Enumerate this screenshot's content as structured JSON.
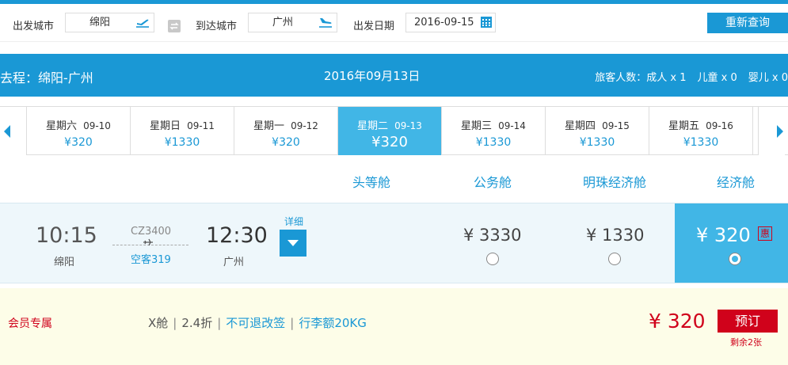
{
  "search": {
    "origin_label": "出发城市",
    "origin_value": "绵阳",
    "dest_label": "到达城市",
    "dest_value": "广州",
    "date_label": "出发日期",
    "date_value": "2016-09-15",
    "requery_label": "重新查询"
  },
  "route": {
    "title": "去程：绵阳-广州",
    "date": "2016年09月13日",
    "pax_label": "旅客人数：",
    "adult": "成人 x 1",
    "child": "儿童 x 0",
    "infant": "婴儿 x 0"
  },
  "date_tabs": [
    {
      "weekday": "星期六",
      "date": "09-10",
      "price": "¥320"
    },
    {
      "weekday": "星期日",
      "date": "09-11",
      "price": "¥1330"
    },
    {
      "weekday": "星期一",
      "date": "09-12",
      "price": "¥320"
    },
    {
      "weekday": "星期二",
      "date": "09-13",
      "price": "¥320",
      "active": true
    },
    {
      "weekday": "星期三",
      "date": "09-14",
      "price": "¥1330"
    },
    {
      "weekday": "星期四",
      "date": "09-15",
      "price": "¥1330"
    },
    {
      "weekday": "星期五",
      "date": "09-16",
      "price": "¥1330"
    }
  ],
  "cabin_headers": [
    "头等舱",
    "公务舱",
    "明珠经济舱",
    "经济舱"
  ],
  "flight": {
    "dep_time": "10:15",
    "dep_city": "绵阳",
    "flight_no": "CZ3400",
    "plane_type": "空客319",
    "arr_time": "12:30",
    "arr_city": "广州",
    "detail_label": "详细",
    "prices": [
      "¥ 3330",
      "¥ 1330",
      "¥ 320"
    ],
    "discount_badge": "惠"
  },
  "member": {
    "title": "会员专属",
    "cabin_class": "X舱",
    "discount": "2.4折",
    "refund": "不可退改签",
    "baggage": "行李额20KG",
    "price": "¥ 320",
    "book_label": "预订",
    "remaining": "剩余2张"
  },
  "colors": {
    "accent": "#1a98d5",
    "accent_light": "#41b6e6",
    "price_red": "#d0021b",
    "member_bg": "#fdfde8"
  }
}
